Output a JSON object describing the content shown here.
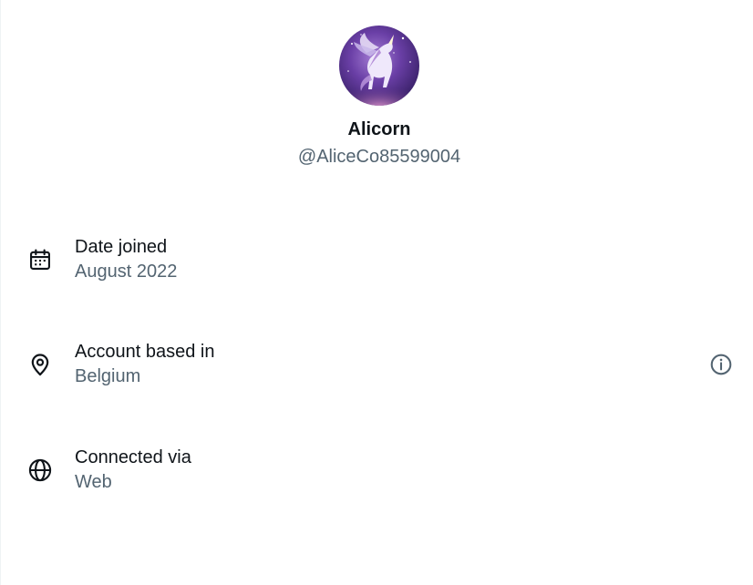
{
  "profile": {
    "display_name": "Alicorn",
    "handle": "@AliceCo85599004",
    "avatar_icon": "pegasus-avatar"
  },
  "details": {
    "date_joined": {
      "icon": "calendar-icon",
      "title": "Date joined",
      "value": "August 2022"
    },
    "account_based_in": {
      "icon": "location-pin-icon",
      "title": "Account based in",
      "value": "Belgium",
      "info_icon": "info-icon"
    },
    "connected_via": {
      "icon": "globe-icon",
      "title": "Connected via",
      "value": "Web"
    }
  },
  "colors": {
    "text_primary": "#0f1419",
    "text_secondary": "#536471",
    "avatar_bg": "#4a2a7a"
  }
}
